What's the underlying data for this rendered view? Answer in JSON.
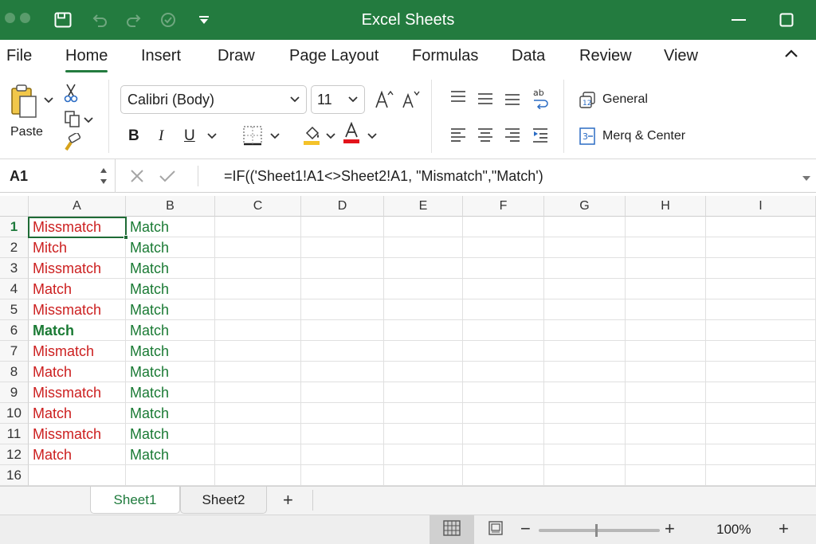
{
  "window": {
    "title": "Excel Sheets"
  },
  "menu": {
    "tabs": [
      {
        "label": "File"
      },
      {
        "label": "Home",
        "active": true
      },
      {
        "label": "Insert"
      },
      {
        "label": "Draw"
      },
      {
        "label": "Page Layout"
      },
      {
        "label": "Formulas"
      },
      {
        "label": "Data"
      },
      {
        "label": "Review"
      },
      {
        "label": "View"
      }
    ]
  },
  "ribbon": {
    "paste_label": "Paste",
    "font_name": "Calibri (Body)",
    "font_size": "11",
    "bold": "B",
    "italic": "I",
    "underline": "U",
    "number_format": "General",
    "merge_center": "Merq & Center",
    "icons": [
      "paste-icon",
      "cut-icon",
      "copy-icon",
      "format-painter-icon",
      "increase-font-icon",
      "decrease-font-icon",
      "borders-icon",
      "fill-color-icon",
      "font-color-icon",
      "align-top-icon",
      "align-middle-icon",
      "align-bottom-icon",
      "wrap-text-icon",
      "align-left-icon",
      "align-center-icon",
      "align-right-icon",
      "indent-icon",
      "number-format-icon",
      "merge-icon"
    ]
  },
  "formula_bar": {
    "name_box": "A1",
    "formula": "=IF(('Sheet1!A1<>Sheet2!A1, \"Mismatch\",\"Match')"
  },
  "grid": {
    "columns": [
      "A",
      "B",
      "C",
      "D",
      "E",
      "F",
      "G",
      "H",
      "I"
    ],
    "rows": [
      {
        "num": "1",
        "a": "Missmatch",
        "a_color": "red",
        "b": "Match",
        "active": true
      },
      {
        "num": "2",
        "a": "Mitch",
        "a_color": "red",
        "b": "Match"
      },
      {
        "num": "3",
        "a": "Missmatch",
        "a_color": "red",
        "b": "Match"
      },
      {
        "num": "4",
        "a": "Match",
        "a_color": "red",
        "b": "Match"
      },
      {
        "num": "5",
        "a": "Missmatch",
        "a_color": "red",
        "b": "Match"
      },
      {
        "num": "6",
        "a": "Match",
        "a_color": "green-bold",
        "b": "Match"
      },
      {
        "num": "7",
        "a": "Mismatch",
        "a_color": "red",
        "b": "Match"
      },
      {
        "num": "8",
        "a": "Match",
        "a_color": "red",
        "b": "Match"
      },
      {
        "num": "9",
        "a": "Missmatch",
        "a_color": "red",
        "b": "Match"
      },
      {
        "num": "10",
        "a": "Match",
        "a_color": "red",
        "b": "Match"
      },
      {
        "num": "11",
        "a": "Missmatch",
        "a_color": "red",
        "b": "Match"
      },
      {
        "num": "12",
        "a": "Match",
        "a_color": "red",
        "b": "Match"
      },
      {
        "num": "16",
        "a": "",
        "a_color": "red",
        "b": ""
      }
    ]
  },
  "sheets": {
    "tabs": [
      {
        "label": "Sheet1",
        "active": true
      },
      {
        "label": "Sheet2"
      }
    ],
    "add_label": "+"
  },
  "status": {
    "zoom": "100%",
    "zoom_minus": "−",
    "zoom_plus": "+"
  },
  "colors": {
    "brand": "#237b3f",
    "mismatch_text": "#cc1f1f",
    "match_text": "#1a7a34"
  }
}
